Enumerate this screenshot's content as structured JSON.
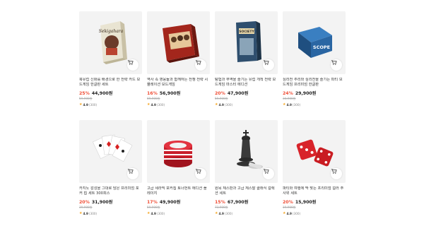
{
  "products": [
    {
      "title": "북유럽 신화를 배경으로 한 전략 카드 보드게임 한글판 세트",
      "discount": "25%",
      "price": "44,900원",
      "original": "59,900원",
      "score": "4.9",
      "reviews": "(300)",
      "image": "box-game-sekigahara"
    },
    {
      "title": "역사 속 영웅들과 함께하는 전쟁 전략 시뮬레이션 보드게임",
      "discount": "16%",
      "price": "56,900원",
      "original": "69,900원",
      "score": "4.9",
      "reviews": "(300)",
      "image": "box-game-red-war"
    },
    {
      "title": "탐험과 무역을 즐기는 유럽 개척 전략 보드게임 마스터 에디션",
      "discount": "20%",
      "price": "47,900원",
      "original": "59,900원",
      "score": "4.9",
      "reviews": "(300)",
      "image": "box-game-society"
    },
    {
      "title": "심리전 추리와 심리전을 즐기는 파티 보드게임 프리미엄 한글판",
      "discount": "24%",
      "price": "29,900원",
      "original": "34,900원",
      "score": "4.9",
      "reviews": "(300)",
      "image": "box-game-scope"
    },
    {
      "title": "카지노 감성을 그대로 담은 프리미엄 포커 칩 세트 300피스",
      "discount": "20%",
      "price": "31,900원",
      "original": "39,900원",
      "score": "4.9",
      "reviews": "(300)",
      "image": "playing-cards"
    },
    {
      "title": "고급 세라믹 포커칩 토너먼트 에디션 플레이지",
      "discount": "17%",
      "price": "49,900원",
      "original": "59,900원",
      "score": "4.9",
      "reviews": "(300)",
      "image": "poker-chips"
    },
    {
      "title": "원목 체스판과 고급 체스말 클래식 컬렉션 세트",
      "discount": "15%",
      "price": "67,900원",
      "original": "73,900원",
      "score": "4.9",
      "reviews": "(300)",
      "image": "chess-king"
    },
    {
      "title": "파티와 여행에 딱 맞는 프리미엄 컬러 주사위 세트",
      "discount": "20%",
      "price": "15,900원",
      "original": "19,900원",
      "score": "4.9",
      "reviews": "(300)",
      "image": "red-dice"
    }
  ],
  "box_texts": {
    "sekigahara": "Sekigahara",
    "society": "SOCIETY",
    "scope": "SCOPE"
  },
  "star_glyph": "★",
  "colors": {
    "discount": "#f04e36",
    "star": "#f5a623"
  }
}
